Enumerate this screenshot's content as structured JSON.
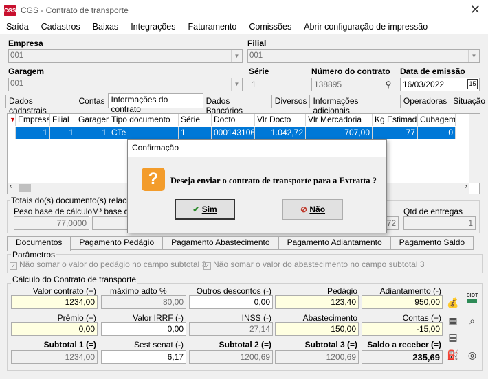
{
  "window": {
    "title": "CGS - Contrato de transporte",
    "logo": "CGS"
  },
  "menu": [
    "Saída",
    "Cadastros",
    "Baixas",
    "Integrações",
    "Faturamento",
    "Comissões",
    "Abrir configuração de impressão"
  ],
  "header": {
    "empresa_label": "Empresa",
    "empresa_value": "001",
    "filial_label": "Filial",
    "filial_value": "001",
    "garagem_label": "Garagem",
    "garagem_value": "001",
    "serie_label": "Série",
    "serie_value": "1",
    "numero_label": "Número do contrato",
    "numero_value": "138895",
    "data_label": "Data de emissão",
    "data_value": "16/03/2022",
    "calendar_icon": "15"
  },
  "tabs": [
    "Dados cadastrais",
    "Contas",
    "Informações do contrato",
    "Dados Bancários",
    "Diversos",
    "Informações adicionais",
    "Operadoras",
    "Situação"
  ],
  "grid": {
    "columns": [
      "Empresa",
      "Filial",
      "Garagem",
      "Tipo documento",
      "Série",
      "Docto",
      "Vlr Docto",
      "Vlr Mercadoria",
      "Kg Estimado",
      "Cubagem"
    ],
    "rows": [
      [
        "1",
        "1",
        "1",
        "CTe",
        "1",
        "000143106",
        "1.042,72",
        "707,00",
        "77",
        "0"
      ]
    ]
  },
  "totais": {
    "title": "Totais do(s) documento(s) relacio",
    "peso_label": "Peso base de cálculo",
    "peso_value": "77,0000",
    "m3_label": "M³ base d",
    "hidden_value": "72",
    "qtd_label": "Qtd de entregas",
    "qtd_value": "1"
  },
  "dialog": {
    "title": "Confirmação",
    "message": "Deseja enviar o contrato de transporte para a Extratta ?",
    "yes": "Sim",
    "no": "Não"
  },
  "bottom_tabs": [
    "Documentos",
    "Pagamento Pedágio",
    "Pagamento Abastecimento",
    "Pagamento Adiantamento",
    "Pagamento Saldo"
  ],
  "parametros": {
    "title": "Parâmetros",
    "opt1": "Não somar o valor do pedágio no campo subtotal 3",
    "opt2": "Não somar o valor do abastecimento no campo subtotal 3"
  },
  "calculo": {
    "title": "Cálculo do Contrato de transporte",
    "valor_contrato_label": "Valor contrato (+)",
    "valor_contrato": "1234,00",
    "max_adto_label": "máximo adto %",
    "max_adto": "80,00",
    "outros_desc_label": "Outros descontos (-)",
    "outros_desc": "0,00",
    "pedagio_label": "Pedágio",
    "pedagio": "123,40",
    "adiantamento_label": "Adiantamento (-)",
    "adiantamento": "950,00",
    "premio_label": "Prêmio (+)",
    "premio": "0,00",
    "irrf_label": "Valor IRRF (-)",
    "irrf": "0,00",
    "inss_label": "INSS (-)",
    "inss": "27,14",
    "abastecimento_label": "Abastecimento",
    "abastecimento": "150,00",
    "contas_label": "Contas (+)",
    "contas": "-15,00",
    "sub1_label": "Subtotal 1 (=)",
    "sub1": "1234,00",
    "sest_label": "Sest senat (-)",
    "sest": "6,17",
    "sub2_label": "Subtotal 2 (=)",
    "sub2": "1200,69",
    "sub3_label": "Subtotal 3 (=)",
    "sub3": "1200,69",
    "saldo_label": "Saldo a receber (=)",
    "saldo": "235,69",
    "ciot_label": "CIOT"
  }
}
